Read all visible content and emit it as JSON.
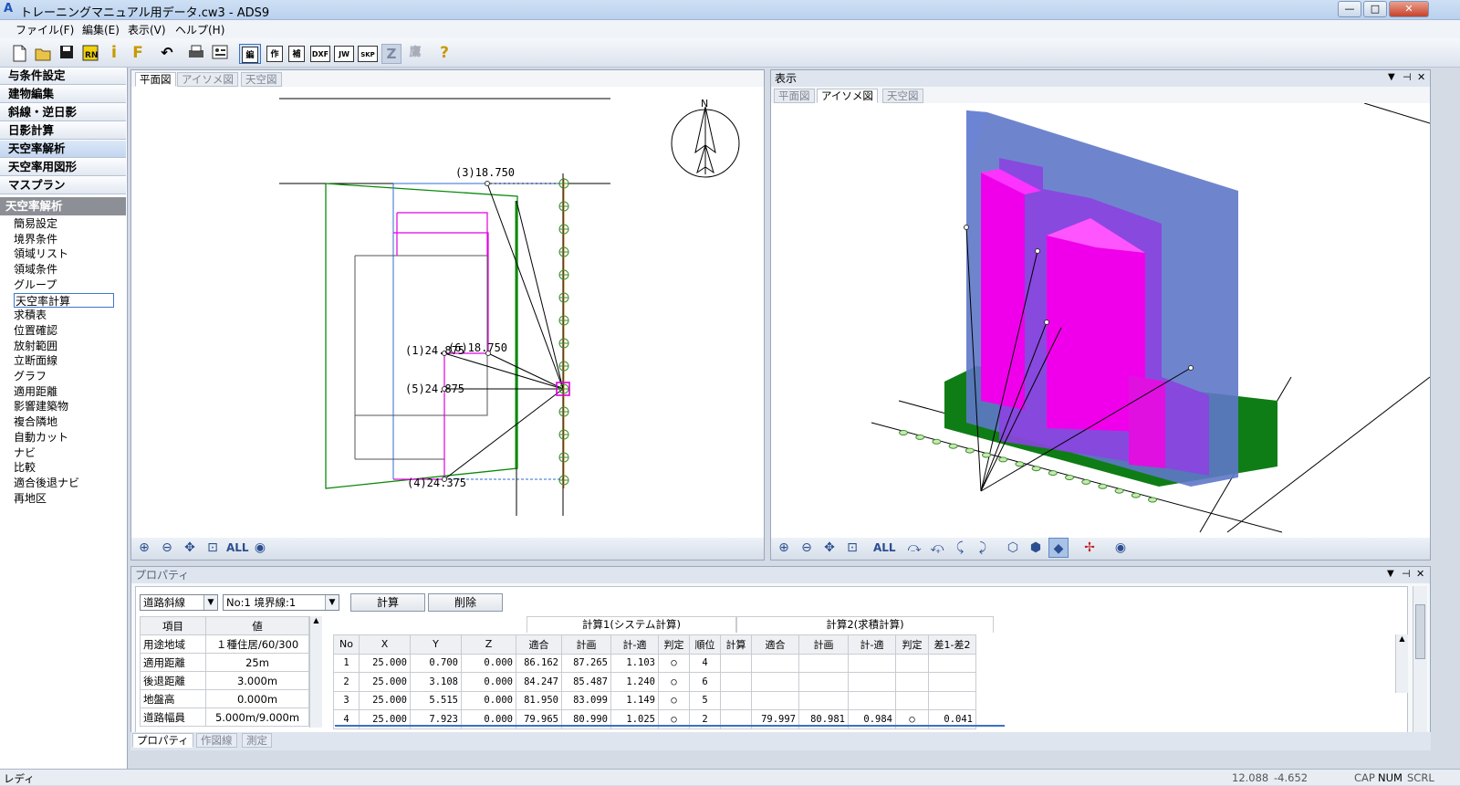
{
  "window": {
    "title": "トレーニングマニュアル用データ.cw3 - ADS9",
    "buttons": {
      "minimize": "—",
      "maximize": "□",
      "close": "✕"
    }
  },
  "menu": [
    "ファイル(F)",
    "編集(E)",
    "表示(V)",
    "ヘルプ(H)"
  ],
  "toolbar": {
    "icons": [
      "new-file-icon",
      "open-folder-icon",
      "save-icon",
      "run-icon",
      "info-icon",
      "flag-icon",
      "undo-icon",
      "print-icon",
      "settings-icon"
    ],
    "modes": [
      "編",
      "作",
      "補",
      "DXF",
      "JW",
      "SKP",
      "Z",
      "鷹"
    ],
    "help": "?"
  },
  "sidebar": {
    "groups": [
      "与条件設定",
      "建物編集",
      "斜線・逆日影",
      "日影計算",
      "天空率解析",
      "天空率用図形",
      "マスプラン"
    ],
    "section_title": "天空率解析",
    "items": [
      "簡易設定",
      "境界条件",
      "領域リスト",
      "領域条件",
      "グループ",
      "天空率計算",
      "求積表",
      "位置確認",
      "放射範囲",
      "立断面線",
      "グラフ",
      "適用距離",
      "影響建築物",
      "複合隣地",
      "自動カット",
      "ナビ",
      "比較",
      "適合後退ナビ",
      "再地区"
    ],
    "selected": "天空率計算"
  },
  "plan_view": {
    "tabs": [
      "平面図",
      "アイソメ図",
      "天空図"
    ],
    "labels": {
      "p3": "(3)18.750",
      "p1": "(1)24.875",
      "p6": "(6)18.750",
      "p5": "(5)24.875",
      "p4": "(4)24.375"
    },
    "north": "N",
    "controls": {
      "all": "ALL"
    }
  },
  "display_view": {
    "title": "表示",
    "tabs": [
      "平面図",
      "アイソメ図",
      "天空図"
    ],
    "controls": {
      "all": "ALL"
    }
  },
  "properties": {
    "title": "プロパティ",
    "select_type": "道路斜線",
    "select_boundary": "No:1 境界線:1",
    "calc_button": "計算",
    "delete_button": "削除",
    "kv_header": [
      "項目",
      "値"
    ],
    "kv": [
      [
        "用途地域",
        "１種住居/60/300"
      ],
      [
        "適用距離",
        "25m"
      ],
      [
        "後退距離",
        "3.000m"
      ],
      [
        "地盤高",
        "0.000m"
      ],
      [
        "道路幅員",
        "5.000m/9.000m"
      ]
    ],
    "group1": "計算1(システム計算)",
    "group2": "計算2(求積計算)",
    "columns": [
      "No",
      "X",
      "Y",
      "Z",
      "適合",
      "計画",
      "計-適",
      "判定",
      "順位",
      "計算",
      "適合",
      "計画",
      "計-適",
      "判定",
      "差1-差2"
    ],
    "rows": [
      [
        "1",
        "25.000",
        "0.700",
        "0.000",
        "86.162",
        "87.265",
        "1.103",
        "○",
        "4",
        "",
        "",
        "",
        "",
        "",
        ""
      ],
      [
        "2",
        "25.000",
        "3.108",
        "0.000",
        "84.247",
        "85.487",
        "1.240",
        "○",
        "6",
        "",
        "",
        "",
        "",
        "",
        ""
      ],
      [
        "3",
        "25.000",
        "5.515",
        "0.000",
        "81.950",
        "83.099",
        "1.149",
        "○",
        "5",
        "",
        "",
        "",
        "",
        "",
        ""
      ],
      [
        "4",
        "25.000",
        "7.923",
        "0.000",
        "79.965",
        "80.990",
        "1.025",
        "○",
        "2",
        "",
        "79.997",
        "80.981",
        "0.984",
        "○",
        "0.041"
      ]
    ],
    "bottom_tabs": [
      "プロパティ",
      "作図線",
      "測定"
    ]
  },
  "status": {
    "ready": "レディ",
    "x": "12.088",
    "y": "-4.652",
    "cap": "CAP",
    "num": "NUM",
    "scrl": "SCRL"
  },
  "colors": {
    "magenta": "#ff00ff",
    "green": "#008000",
    "blue_vol": "#5a73c8",
    "purple_vol": "#8a4ee0",
    "accent": "#3a72c4"
  }
}
